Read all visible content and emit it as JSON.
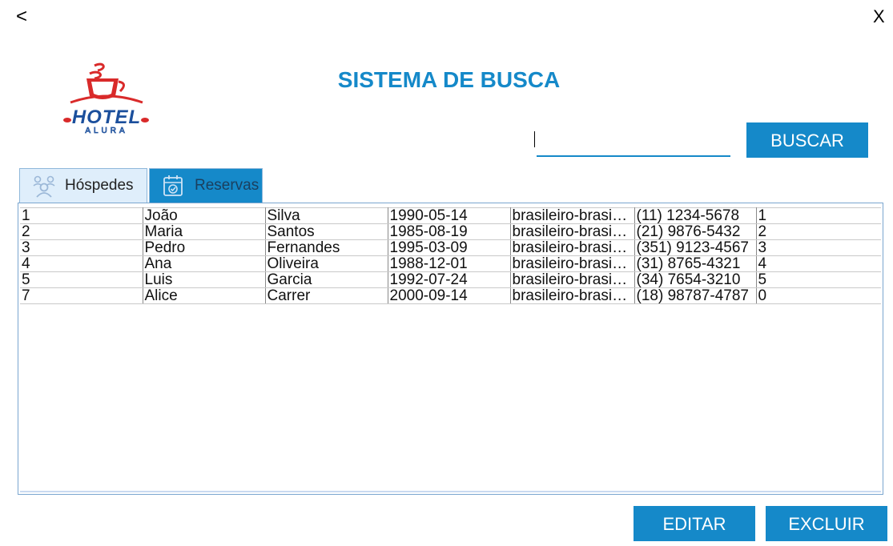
{
  "window": {
    "back_label": "<",
    "close_label": "X"
  },
  "logo": {
    "text_main": "HOTEL",
    "text_sub": "ALURA"
  },
  "page_title": "SISTEMA DE BUSCA",
  "search": {
    "value": "",
    "button_label": "BUSCAR"
  },
  "tabs": [
    {
      "label": "Hóspedes",
      "icon": "guests-icon",
      "active": true
    },
    {
      "label": "Reservas",
      "icon": "calendar-icon",
      "active": false
    }
  ],
  "table": {
    "rows": [
      [
        "1",
        "João",
        "Silva",
        "1990-05-14",
        "brasileiro-brasi…",
        "(11) 1234-5678",
        "1"
      ],
      [
        "2",
        "Maria",
        "Santos",
        "1985-08-19",
        "brasileiro-brasi…",
        "(21) 9876-5432",
        "2"
      ],
      [
        "3",
        "Pedro",
        "Fernandes",
        "1995-03-09",
        "brasileiro-brasi…",
        "(351) 9123-4567",
        "3"
      ],
      [
        "4",
        "Ana",
        "Oliveira",
        "1988-12-01",
        "brasileiro-brasi…",
        "(31) 8765-4321",
        "4"
      ],
      [
        "5",
        "Luis",
        "Garcia",
        "1992-07-24",
        "brasileiro-brasi…",
        "(34) 7654-3210",
        "5"
      ],
      [
        "7",
        "Alice",
        "Carrer",
        "2000-09-14",
        "brasileiro-brasi…",
        "(18) 98787-4787",
        "0"
      ]
    ]
  },
  "actions": {
    "edit_label": "EDITAR",
    "delete_label": "EXCLUIR"
  },
  "colors": {
    "accent": "#1589c9",
    "logo_red": "#d92a2a",
    "logo_blue": "#1b4f9c"
  }
}
